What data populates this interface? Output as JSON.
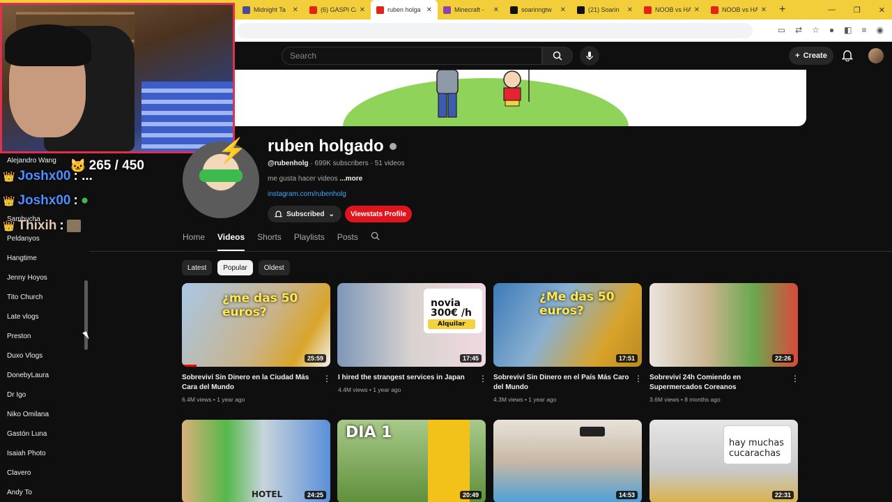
{
  "browser": {
    "tabs": [
      {
        "label": "Midnight Ta",
        "color": "#4a4a9a",
        "active": false
      },
      {
        "label": "(6) GASPI C/",
        "color": "#e62117",
        "active": false
      },
      {
        "label": "ruben holga",
        "color": "#e62117",
        "active": true
      },
      {
        "label": "Minecraft - ",
        "color": "#8e44ad",
        "active": false
      },
      {
        "label": "soarinngtw",
        "color": "#111111",
        "active": false
      },
      {
        "label": "(21) Soarin",
        "color": "#111111",
        "active": false
      },
      {
        "label": "NOOB vs HA",
        "color": "#e62117",
        "active": false
      },
      {
        "label": "NOOB vs HA",
        "color": "#e62117",
        "active": false
      }
    ],
    "new_tab": "+"
  },
  "header": {
    "search_placeholder": "Search",
    "create_label": "Create"
  },
  "overlay": {
    "viewer_count": "265 / 450",
    "chat": [
      {
        "user": "Joshx00",
        "msg": ": ..."
      },
      {
        "user": "Joshx00",
        "msg": ":"
      },
      {
        "user": "Thixih",
        "msg": ":"
      }
    ]
  },
  "sidebar": {
    "items": [
      "Alejandro Wang",
      "Sambucha",
      "Peldanyos",
      "Hangtime",
      "Jenny Hoyos",
      "Tito Church",
      "Late vlogs",
      "Preston",
      "Duxo Vlogs",
      "DonebyLaura",
      "Dr Igo",
      "Niko Omilana",
      "Gastón Luna",
      "Isaiah Photo",
      "Clavero",
      "Andy To"
    ]
  },
  "channel": {
    "name": "ruben holgado",
    "handle": "@rubenholg",
    "subscribers": "699K subscribers",
    "videos_count": "51 videos",
    "description": "me gusta hacer videos",
    "more": "...more",
    "link": "instagram.com/rubenholg",
    "subscribed_label": "Subscribed",
    "viewstats_label": "Viewstats Profile"
  },
  "tabs": [
    "Home",
    "Videos",
    "Shorts",
    "Playlists",
    "Posts"
  ],
  "active_tab": "Videos",
  "chips": [
    "Latest",
    "Popular",
    "Oldest"
  ],
  "active_chip": "Popular",
  "videos": [
    {
      "title": "Sobreviví Sin Dinero en la Ciudad Más Cara del Mundo",
      "views": "6.4M views",
      "age": "1 year ago",
      "duration": "25:59",
      "thumb_text": "¿me das 50 euros?",
      "progress": 0.1
    },
    {
      "title": "I hired the strangest services in Japan",
      "views": "4.4M views",
      "age": "1 year ago",
      "duration": "17:45",
      "thumb_text": "novia 300€ /h",
      "thumb_text2": "Alquilar",
      "progress": 0
    },
    {
      "title": "Sobreviví Sin Dinero en el País Más Caro del Mundo",
      "views": "4.3M views",
      "age": "1 year ago",
      "duration": "17:51",
      "thumb_text": "¿Me das 50 euros?",
      "progress": 0
    },
    {
      "title": "Sobreviví 24h Comiendo en Supermercados Coreanos",
      "views": "3.6M views",
      "age": "8 months ago",
      "duration": "22:26",
      "thumb_text": "",
      "progress": 0
    },
    {
      "title": "",
      "views": "",
      "age": "",
      "duration": "24:25",
      "thumb_text": "HOTEL",
      "progress": 0
    },
    {
      "title": "",
      "views": "",
      "age": "",
      "duration": "20:49",
      "thumb_text": "DIA 1",
      "progress": 0
    },
    {
      "title": "",
      "views": "",
      "age": "",
      "duration": "14:53",
      "thumb_text": "",
      "progress": 0
    },
    {
      "title": "",
      "views": "",
      "age": "",
      "duration": "22:31",
      "thumb_text": "hay muchas cucarachas",
      "progress": 0
    }
  ]
}
